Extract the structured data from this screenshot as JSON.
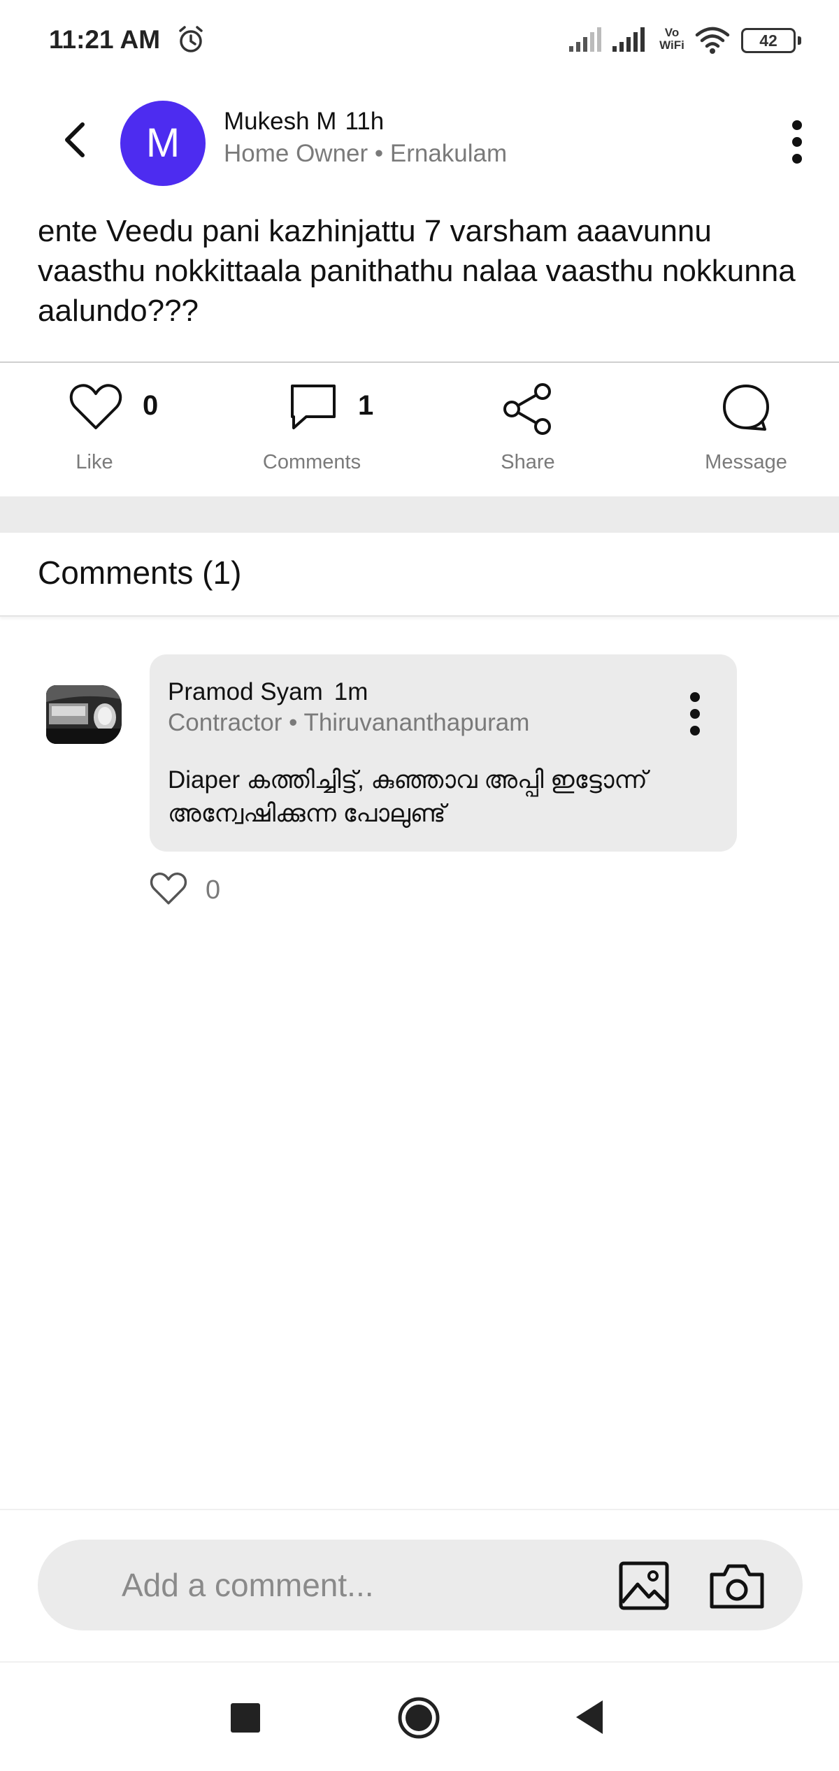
{
  "status_bar": {
    "time": "11:21 AM",
    "network": "Vo WiFi",
    "network_line1": "Vo",
    "network_line2": "WiFi",
    "battery": "42",
    "icons": [
      "alarm-icon",
      "signal-icon",
      "signal-icon",
      "wifi-icon",
      "battery-icon"
    ]
  },
  "post": {
    "author_initial": "M",
    "author_name": "Mukesh M",
    "time_ago": "11h",
    "role": "Home Owner",
    "location": "Ernakulam",
    "meta": "Home Owner • Ernakulam",
    "text": "ente Veedu pani kazhinjattu 7 varsham aaavunnu vaasthu nokkittaala panithathu nalaa vaasthu nokkunna aalundo???",
    "avatar_color": "#4d2cf0"
  },
  "actions": {
    "like": {
      "label": "Like",
      "count": "0"
    },
    "comments": {
      "label": "Comments",
      "count": "1"
    },
    "share": {
      "label": "Share"
    },
    "message": {
      "label": "Message"
    }
  },
  "comments_section": {
    "title": "Comments (1)",
    "items": [
      {
        "author_name": "Pramod Syam",
        "time_ago": "1m",
        "meta": "Contractor • Thiruvananthapuram",
        "text": "Diaper കത്തിച്ചിട്ട്, കുഞ്ഞാവ അപ്പി ഇട്ടോന്ന് അന്വേഷിക്കുന്ന പോലുണ്ട്",
        "like_count": "0"
      }
    ]
  },
  "composer": {
    "placeholder": "Add a comment..."
  },
  "colors": {
    "accent": "#4d2cf0",
    "muted_text": "#7a7a7a",
    "bubble_bg": "#ebebeb"
  }
}
